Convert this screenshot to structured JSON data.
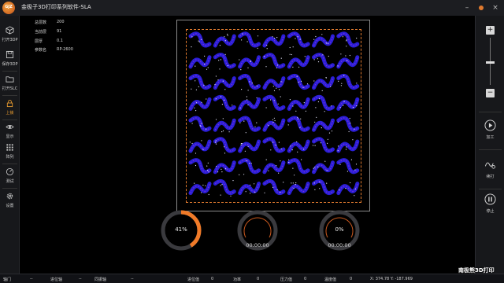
{
  "app": {
    "title": "金极子3D打印系列软件-SLA",
    "logo_text": "GJZ"
  },
  "window": {
    "minimize": "–",
    "maximize": "□",
    "close": "×"
  },
  "sidebar": {
    "items": [
      {
        "label": "打开3DP",
        "icon": "cube-icon"
      },
      {
        "label": "保存3DP",
        "icon": "save-icon"
      },
      {
        "label": "打开SLC",
        "icon": "folder-icon"
      },
      {
        "label": "上锁",
        "icon": "lock-icon"
      },
      {
        "label": "显示",
        "icon": "eye-icon"
      },
      {
        "label": "阵列",
        "icon": "grid-icon"
      },
      {
        "label": "测试",
        "icon": "gauge-icon"
      },
      {
        "label": "设置",
        "icon": "gear-icon"
      }
    ]
  },
  "info": {
    "rows": [
      {
        "key": "总层数",
        "value": "200"
      },
      {
        "key": "当前层",
        "value": "91"
      },
      {
        "key": "层厚",
        "value": "0.1"
      },
      {
        "key": "参数名",
        "value": "RP-2600"
      }
    ]
  },
  "gauges": {
    "progress": {
      "label": "41%",
      "fraction": 0.41,
      "color": "#f07a28"
    },
    "timer1": {
      "label": "00:00:00"
    },
    "timer2": {
      "value": "0%",
      "label": "00:00:00"
    }
  },
  "rightbar": {
    "zoom_in": "+",
    "zoom_out": "−",
    "items": [
      {
        "label": "加工",
        "icon": "play-icon"
      },
      {
        "label": "续打",
        "icon": "resume-icon"
      },
      {
        "label": "停止",
        "icon": "pause-icon"
      }
    ]
  },
  "status": {
    "items": [
      {
        "label": "轴门",
        "value": "--"
      },
      {
        "label": "进位轴",
        "value": "--"
      },
      {
        "label": "同振轴",
        "value": "--"
      },
      {
        "label": "进位值",
        "value": "0"
      },
      {
        "label": "功率",
        "value": "0"
      },
      {
        "label": "压力值",
        "value": "0"
      },
      {
        "label": "温度值",
        "value": "0"
      }
    ],
    "coords": "X: 374.78 Y: -187.969"
  },
  "watermark": "南极熊3D打印",
  "colors": {
    "accent": "#e07a2e",
    "part_blue": "#2a1fd8",
    "part_purple": "#8a2fd0"
  }
}
